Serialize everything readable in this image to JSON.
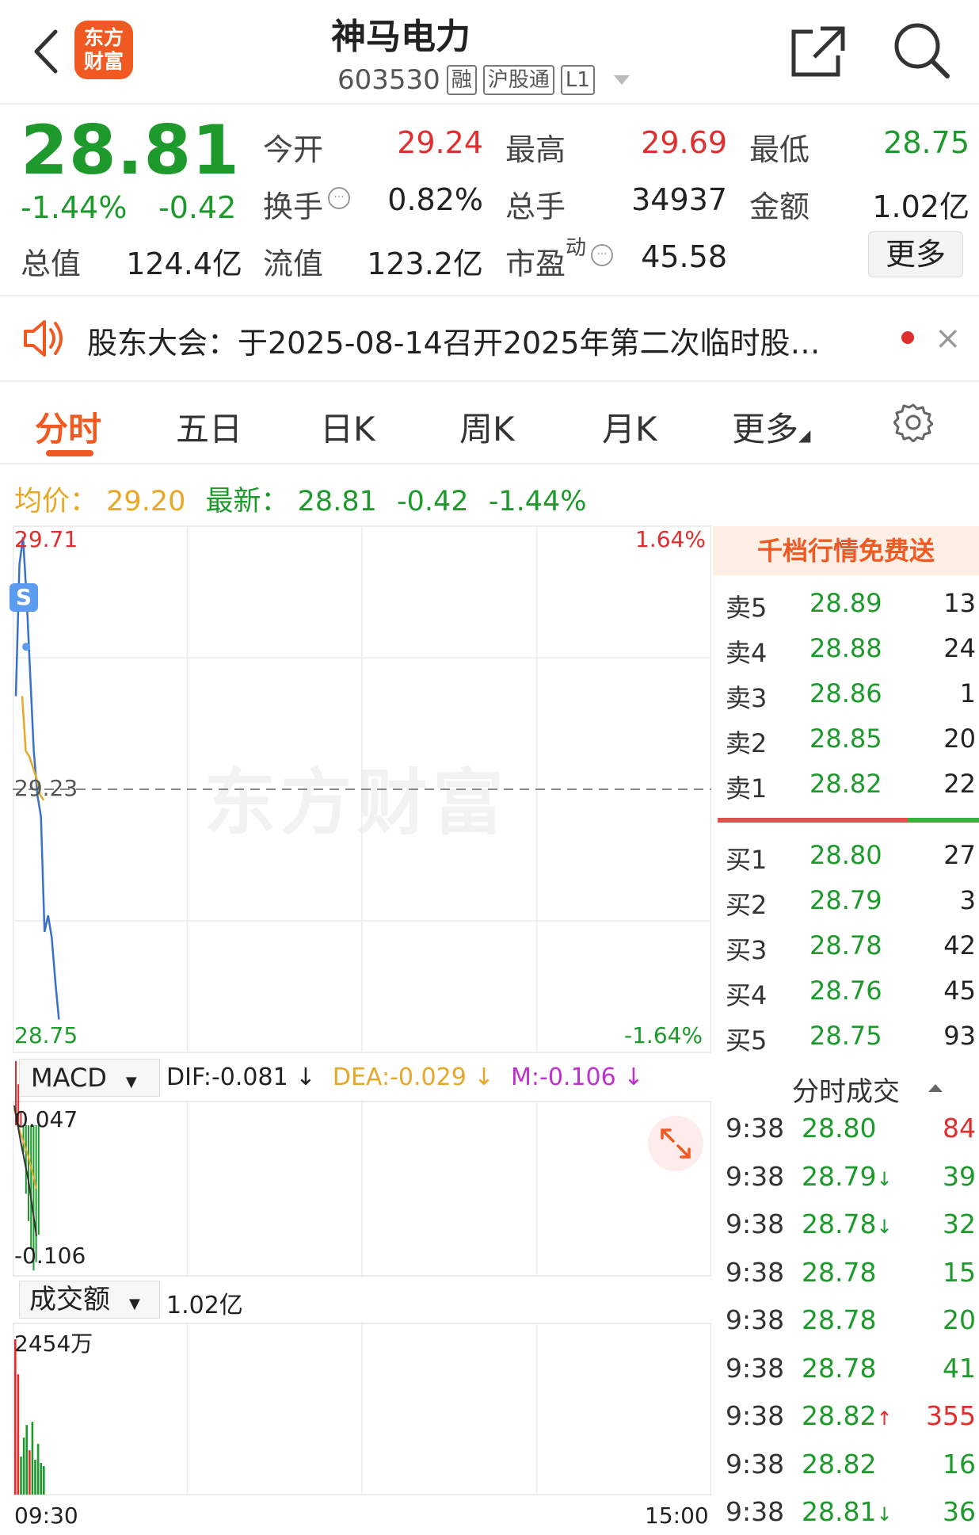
{
  "header": {
    "stock_name": "神马电力",
    "stock_code": "603530",
    "tags": [
      "融",
      "沪股通",
      "L1"
    ],
    "logo_line1": "东方",
    "logo_line2": "财富"
  },
  "quote": {
    "price": "28.81",
    "change_pct": "-1.44%",
    "change_abs": "-0.42",
    "rows": [
      [
        {
          "label": "今开",
          "value": "29.24",
          "color": "red"
        },
        {
          "label": "最高",
          "value": "29.69",
          "color": "red"
        },
        {
          "label": "最低",
          "value": "28.75",
          "color": "green"
        }
      ],
      [
        {
          "label": "换手",
          "value": "0.82%",
          "color": "dark"
        },
        {
          "label": "总手",
          "value": "34937",
          "color": "dark"
        },
        {
          "label": "金额",
          "value": "1.02亿",
          "color": "dark"
        }
      ]
    ],
    "total_value_label": "总值",
    "total_value": "124.4亿",
    "float_value_label": "流值",
    "float_value": "123.2亿",
    "pe_label": "市盈",
    "pe_sup": "动",
    "pe_value": "45.58",
    "more_label": "更多"
  },
  "notice": {
    "text": "股东大会：于2025-08-14召开2025年第二次临时股…",
    "close": "×"
  },
  "tabs": [
    "分时",
    "五日",
    "日K",
    "周K",
    "月K",
    "更多"
  ],
  "avg_row": {
    "avg_label": "均价：",
    "avg_value": "29.20",
    "latest_label": "最新：",
    "latest_value": "28.81",
    "latest_chg": "-0.42",
    "latest_pct": "-1.44%"
  },
  "chart_data": {
    "type": "line",
    "y_high": "29.71",
    "y_mid": "29.23",
    "y_low": "28.75",
    "pct_high": "1.64%",
    "pct_low": "-1.64%",
    "x_start": "09:30",
    "x_end": "15:00",
    "ylim": [
      28.75,
      29.71
    ],
    "pre_close": 29.23,
    "price_series": [
      29.4,
      29.64,
      29.69,
      29.58,
      29.44,
      29.3,
      29.22,
      29.18,
      28.97,
      29.0,
      28.96,
      28.88,
      28.81
    ],
    "avg_series": [
      29.4,
      29.3,
      29.29,
      29.27,
      29.25,
      29.22,
      29.21
    ],
    "macd": {
      "select_label": "MACD",
      "dif": "DIF:-0.081",
      "dea": "DEA:-0.029",
      "m": "M:-0.106",
      "top": "0.047",
      "bottom": "-0.106"
    },
    "volume": {
      "select_label": "成交额",
      "total": "1.02亿",
      "max_label": "2454万",
      "bars": [
        {
          "v": 2454,
          "c": "red"
        },
        {
          "v": 1900,
          "c": "red"
        },
        {
          "v": 600,
          "c": "green"
        },
        {
          "v": 900,
          "c": "green"
        },
        {
          "v": 1100,
          "c": "green"
        },
        {
          "v": 700,
          "c": "red"
        },
        {
          "v": 1150,
          "c": "green"
        },
        {
          "v": 550,
          "c": "green"
        },
        {
          "v": 800,
          "c": "green"
        },
        {
          "v": 500,
          "c": "green"
        },
        {
          "v": 450,
          "c": "green"
        }
      ]
    }
  },
  "order_book": {
    "banner": "千档行情免费送",
    "asks": [
      {
        "label": "卖5",
        "price": "28.89",
        "vol": "13"
      },
      {
        "label": "卖4",
        "price": "28.88",
        "vol": "24"
      },
      {
        "label": "卖3",
        "price": "28.86",
        "vol": "1"
      },
      {
        "label": "卖2",
        "price": "28.85",
        "vol": "20"
      },
      {
        "label": "卖1",
        "price": "28.82",
        "vol": "22"
      }
    ],
    "bids": [
      {
        "label": "买1",
        "price": "28.80",
        "vol": "27"
      },
      {
        "label": "买2",
        "price": "28.79",
        "vol": "3"
      },
      {
        "label": "买3",
        "price": "28.78",
        "vol": "42"
      },
      {
        "label": "买4",
        "price": "28.76",
        "vol": "45"
      },
      {
        "label": "买5",
        "price": "28.75",
        "vol": "93"
      }
    ]
  },
  "trades": {
    "title": "分时成交",
    "rows": [
      {
        "time": "9:38",
        "price": "28.80",
        "arrow": "",
        "vol": "84",
        "vol_color": "red"
      },
      {
        "time": "9:38",
        "price": "28.79",
        "arrow": "↓",
        "vol": "39",
        "vol_color": "green"
      },
      {
        "time": "9:38",
        "price": "28.78",
        "arrow": "↓",
        "vol": "32",
        "vol_color": "green"
      },
      {
        "time": "9:38",
        "price": "28.78",
        "arrow": "",
        "vol": "15",
        "vol_color": "green"
      },
      {
        "time": "9:38",
        "price": "28.78",
        "arrow": "",
        "vol": "20",
        "vol_color": "green"
      },
      {
        "time": "9:38",
        "price": "28.78",
        "arrow": "",
        "vol": "41",
        "vol_color": "green"
      },
      {
        "time": "9:38",
        "price": "28.82",
        "arrow": "↑",
        "vol": "355",
        "vol_color": "red"
      },
      {
        "time": "9:38",
        "price": "28.82",
        "arrow": "",
        "vol": "16",
        "vol_color": "green"
      },
      {
        "time": "9:38",
        "price": "28.81",
        "arrow": "↓",
        "vol": "36",
        "vol_color": "green"
      }
    ]
  },
  "watermark": "东方财富",
  "s_badge": "S"
}
